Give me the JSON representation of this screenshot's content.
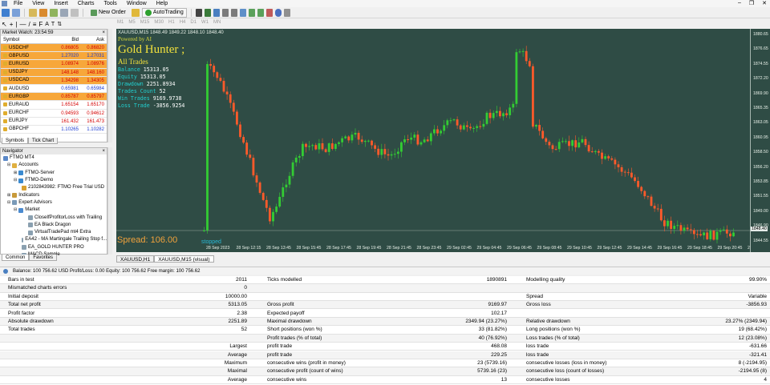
{
  "menu": [
    "File",
    "View",
    "Insert",
    "Charts",
    "Tools",
    "Window",
    "Help"
  ],
  "toolbar": {
    "new_order": "New Order",
    "auto_trading": "AutoTrading"
  },
  "timeframes": [
    "M1",
    "M5",
    "M15",
    "M30",
    "H1",
    "H4",
    "D1",
    "W1",
    "MN"
  ],
  "market_watch": {
    "title": "Market Watch: 23:54:59",
    "headers": [
      "Symbol",
      "Bid",
      "Ask"
    ],
    "rows": [
      {
        "symbol": "USDCHF",
        "bid": "0.86805",
        "ask": "0.86820",
        "hl": true
      },
      {
        "symbol": "GBPUSD",
        "bid": "1.27020",
        "ask": "1.27031",
        "hl": true,
        "blue": true
      },
      {
        "symbol": "EURUSD",
        "bid": "1.08974",
        "ask": "1.08976",
        "hl": true
      },
      {
        "symbol": "USDJPY",
        "bid": "148.148",
        "ask": "148.160",
        "hl": true
      },
      {
        "symbol": "USDCAD",
        "bid": "1.34298",
        "ask": "1.34305",
        "hl": true
      },
      {
        "symbol": "AUDUSD",
        "bid": "0.65981",
        "ask": "0.65984",
        "hl": false,
        "blue": true
      },
      {
        "symbol": "EURGBP",
        "bid": "0.85787",
        "ask": "0.85797",
        "hl": true
      },
      {
        "symbol": "EURAUD",
        "bid": "1.65154",
        "ask": "1.65170",
        "hl": false
      },
      {
        "symbol": "EURCHF",
        "bid": "0.94593",
        "ask": "0.94612",
        "hl": false
      },
      {
        "symbol": "EURJPY",
        "bid": "161.432",
        "ask": "161.473",
        "hl": false
      },
      {
        "symbol": "GBPCHF",
        "bid": "1.10265",
        "ask": "1.10282",
        "hl": false,
        "blue": true
      }
    ],
    "tabs": [
      "Symbols",
      "Tick Chart"
    ]
  },
  "navigator": {
    "title": "Navigator",
    "items": [
      "FTMO MT4",
      "Accounts",
      "FTMO-Server",
      "FTMO-Demo",
      "2102843982: FTMO Free Trial USD",
      "Indicators",
      "Expert Advisors",
      "Market",
      "CloseIfProfitorLoss with Trailing",
      "EA Black Dragon",
      "VirtualTradePad mt4 Extra",
      "EA42 - MA Martingale Trailing Stop f...",
      "EA_GOLD HUNTER PRO",
      "MACD Sample"
    ],
    "tabs": [
      "Common",
      "Favorites"
    ]
  },
  "chart": {
    "title": "XAUUSD,M15  1848.49 1849.22 1848.10 1848.40",
    "ea": {
      "powered": "Powered by AI",
      "name": "Gold Hunter ;",
      "all_trades": "All Trades",
      "stats": [
        {
          "k": "Balance",
          "v": "15313.05"
        },
        {
          "k": "Equity",
          "v": "15313.05"
        },
        {
          "k": "Drawdown",
          "v": "2251.8934"
        },
        {
          "k": "Trades Count",
          "v": "52"
        },
        {
          "k": "Win Trades",
          "v": "9169.9738"
        },
        {
          "k": "Loss Trade",
          "v": "-3856.9254"
        }
      ],
      "spread": "Spread: 106.00",
      "status": "stopped"
    },
    "prices": [
      "1880.65",
      "1876.65",
      "1874.55",
      "1872.20",
      "1869.90",
      "1865.35",
      "1863.05",
      "1860.95",
      "1858.50",
      "1856.20",
      "1853.85",
      "1851.55",
      "1849.00",
      "1846.90",
      "1844.55"
    ],
    "current_price": "1848.40",
    "times": [
      "28 Sep 2023",
      "28 Sep 12:15",
      "28 Sep 13:45",
      "28 Sep 15:45",
      "28 Sep 17:45",
      "28 Sep 19:45",
      "28 Sep 21:45",
      "28 Sep 23:45",
      "29 Sep 02:45",
      "29 Sep 04:45",
      "29 Sep 06:45",
      "29 Sep 08:45",
      "29 Sep 10:45",
      "29 Sep 12:45",
      "29 Sep 14:45",
      "29 Sep 16:45",
      "29 Sep 18:45",
      "29 Sep 20:45",
      "29 Sep 22:45"
    ],
    "tabs": [
      "XAUUSD,H1",
      "XAUUSD,M15 (visual)"
    ]
  },
  "terminal": {
    "header": "Balance: 100 756.62 USD  Profit/Loss: 0.00  Equity: 100 756.62  Free margin: 100 756.62"
  },
  "report": [
    {
      "a": "Bars in test",
      "av": "2011",
      "b": "Ticks modelled",
      "bv": "1890891",
      "c": "Modelling quality",
      "cv": "99.90%"
    },
    {
      "a": "Mismatched charts errors",
      "av": "0",
      "b": "",
      "bv": "",
      "c": "",
      "cv": ""
    },
    {
      "a": "Initial deposit",
      "av": "10000.00",
      "b": "",
      "bv": "",
      "c": "Spread",
      "cv": "Variable"
    },
    {
      "a": "Total net profit",
      "av": "5313.05",
      "b": "Gross profit",
      "bv": "9169.97",
      "c": "Gross loss",
      "cv": "-3856.93"
    },
    {
      "a": "Profit factor",
      "av": "2.38",
      "b": "Expected payoff",
      "bv": "102.17",
      "c": "",
      "cv": ""
    },
    {
      "a": "Absolute drawdown",
      "av": "2251.89",
      "b": "Maximal drawdown",
      "bv": "2349.94 (23.27%)",
      "c": "Relative drawdown",
      "cv": "23.27% (2349.94)"
    },
    {
      "a": "Total trades",
      "av": "52",
      "b": "Short positions (won %)",
      "bv": "33 (81.82%)",
      "c": "Long positions (won %)",
      "cv": "19 (68.42%)"
    },
    {
      "a": "",
      "av": "",
      "b": "Profit trades (% of total)",
      "bv": "40 (76.92%)",
      "c": "Loss trades (% of total)",
      "cv": "12 (23.08%)"
    },
    {
      "a": "",
      "av": "Largest",
      "b": "profit trade",
      "bv": "468.08",
      "c": "loss trade",
      "cv": "-631.66"
    },
    {
      "a": "",
      "av": "Average",
      "b": "profit trade",
      "bv": "229.25",
      "c": "loss trade",
      "cv": "-321.41"
    },
    {
      "a": "",
      "av": "Maximum",
      "b": "consecutive wins (profit in money)",
      "bv": "23 (5739.16)",
      "c": "consecutive losses (loss in money)",
      "cv": "8 (-2194.95)"
    },
    {
      "a": "",
      "av": "Maximal",
      "b": "consecutive profit (count of wins)",
      "bv": "5739.16 (23)",
      "c": "consecutive loss (count of losses)",
      "cv": "-2194.95 (8)"
    },
    {
      "a": "",
      "av": "Average",
      "b": "consecutive wins",
      "bv": "13",
      "c": "consecutive losses",
      "cv": "4"
    }
  ]
}
